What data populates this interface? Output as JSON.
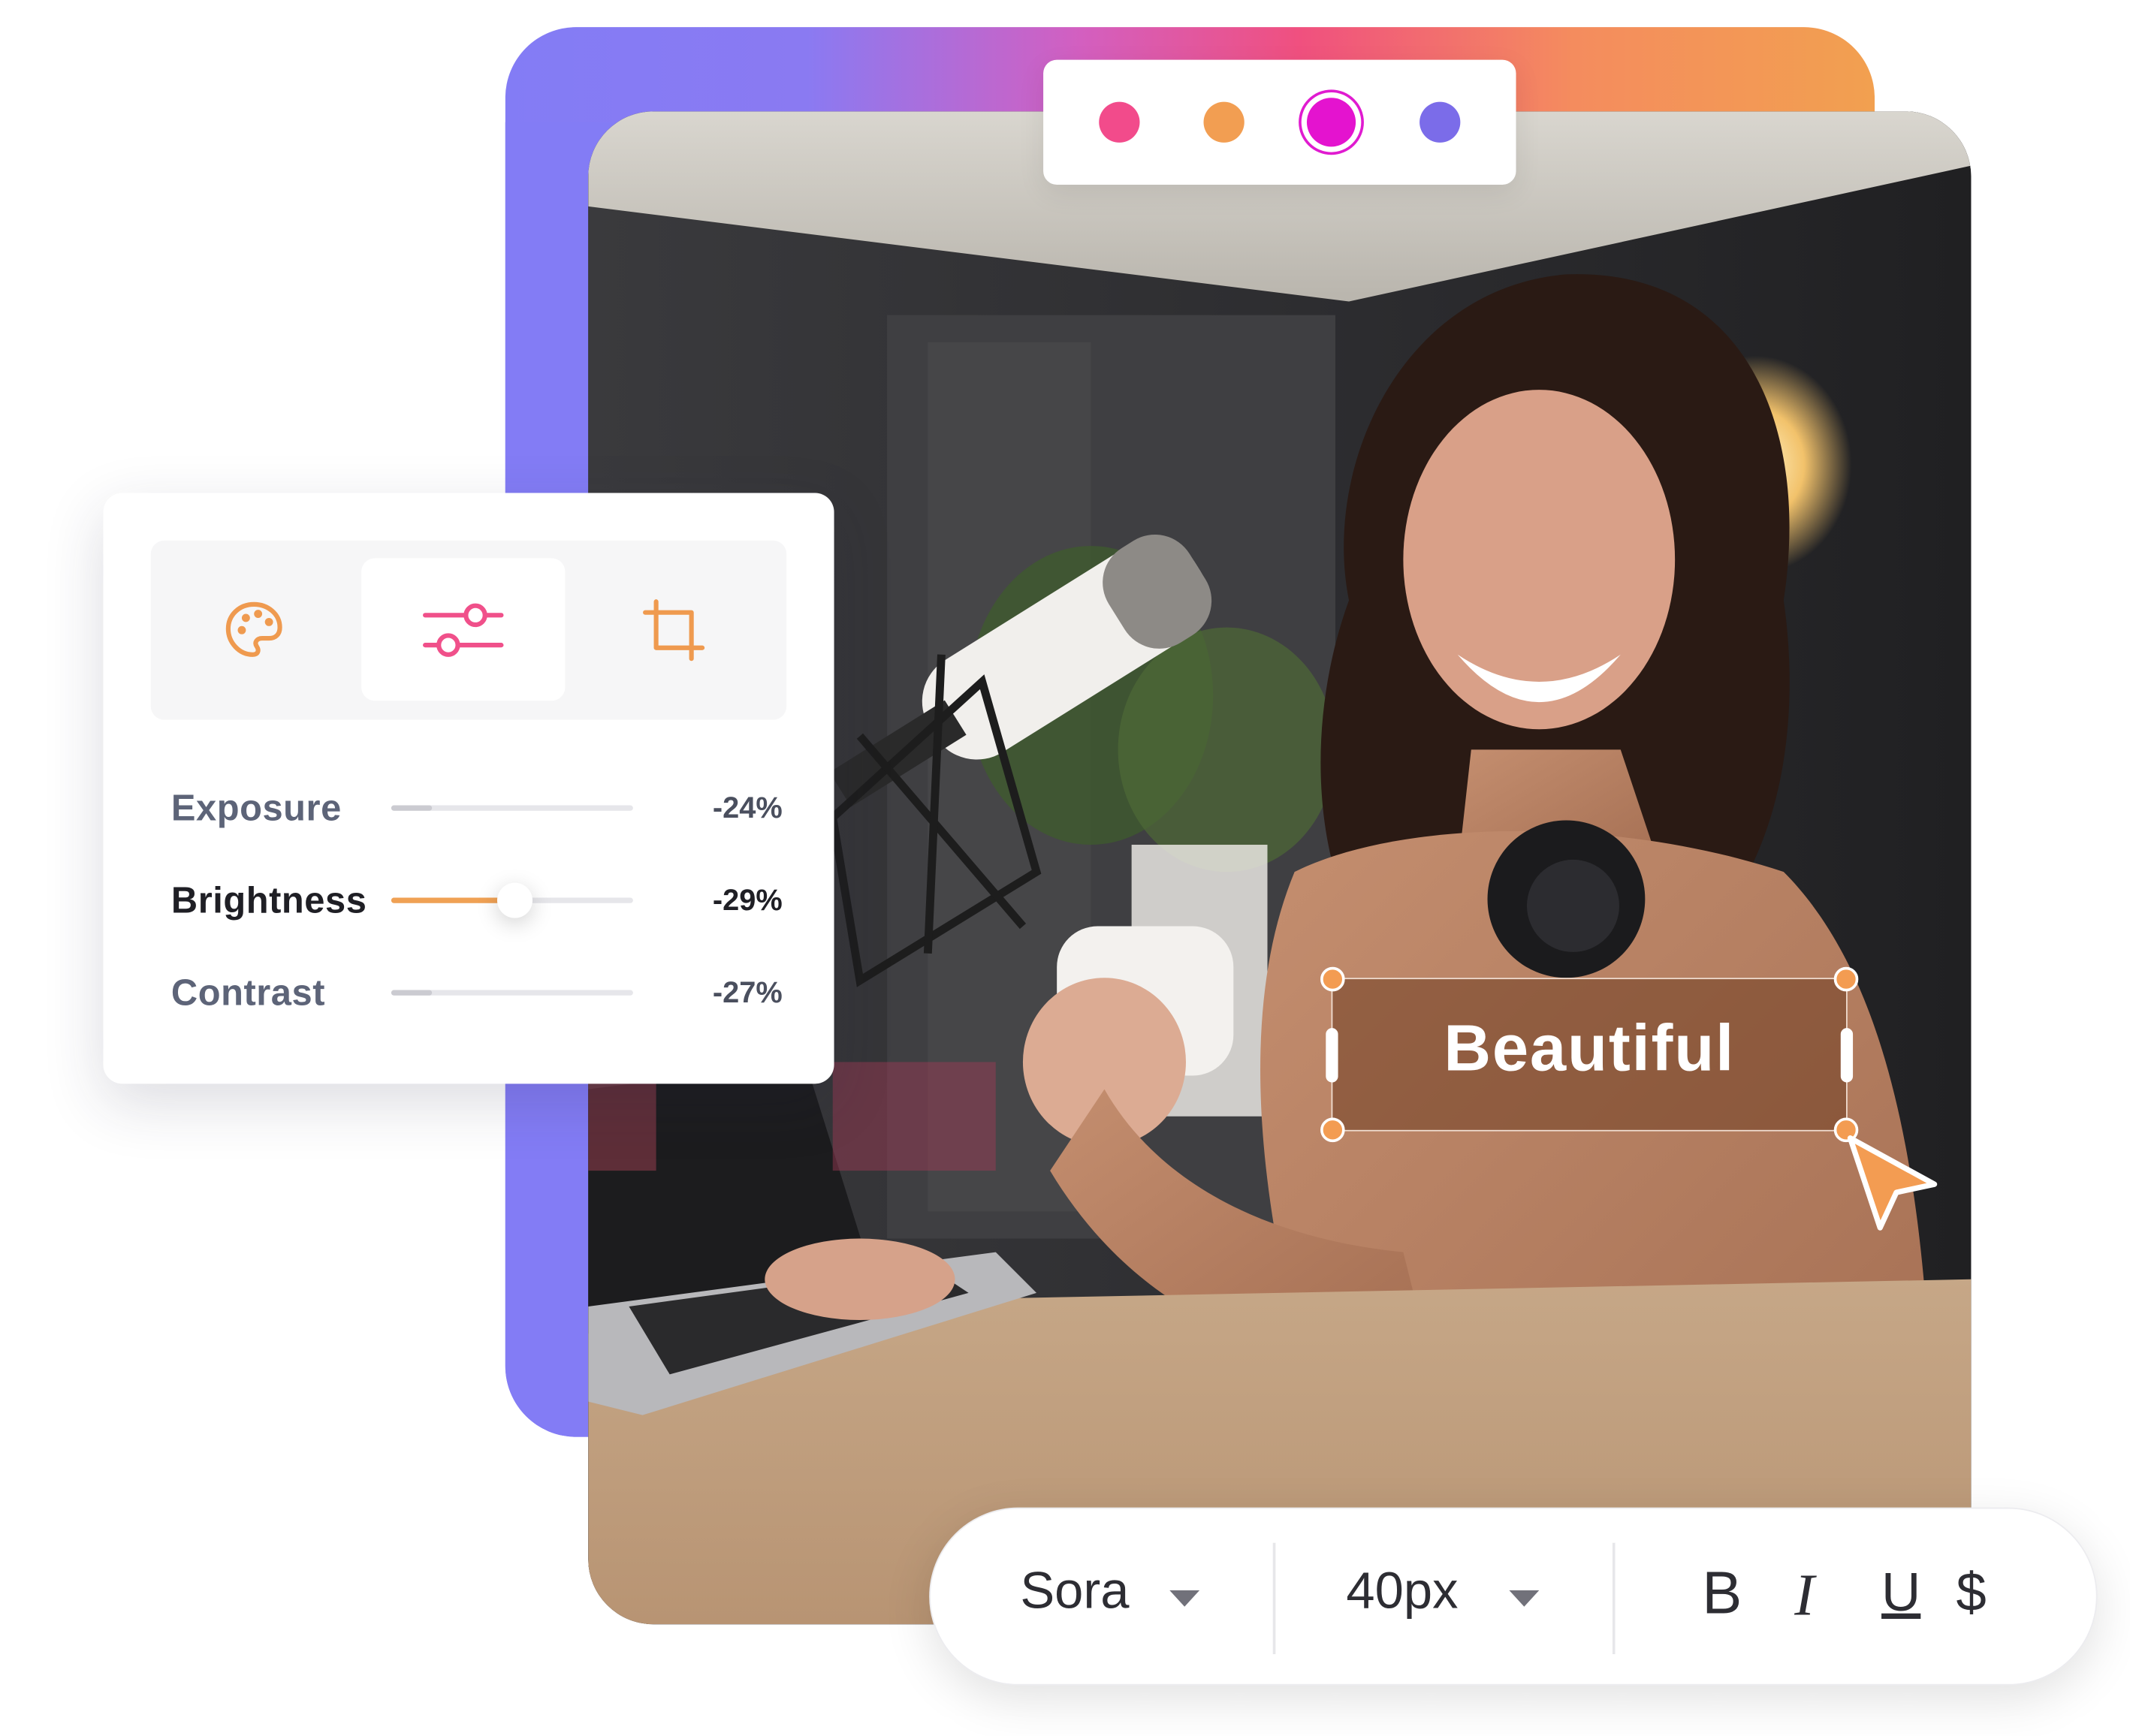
{
  "color_picker": {
    "swatches": [
      {
        "name": "pink",
        "color": "#f24b8b",
        "selected": false
      },
      {
        "name": "orange",
        "color": "#f29e52",
        "selected": false
      },
      {
        "name": "magenta",
        "color": "#e413cf",
        "selected": true
      },
      {
        "name": "purple",
        "color": "#7b6ce9",
        "selected": false
      }
    ]
  },
  "adjust_panel": {
    "tabs": [
      {
        "icon": "palette-icon",
        "active": false
      },
      {
        "icon": "sliders-icon",
        "active": true
      },
      {
        "icon": "crop-icon",
        "active": false
      }
    ],
    "adjustments": [
      {
        "label": "Exposure",
        "value": "-24%",
        "level": 0.17,
        "active": false
      },
      {
        "label": "Brightness",
        "value": "-29%",
        "level": 0.51,
        "active": true
      },
      {
        "label": "Contrast",
        "value": "-27%",
        "level": 0.17,
        "active": false
      }
    ]
  },
  "canvas": {
    "text_layer": "Beautiful",
    "cursor_icon": "pointer-arrow-icon"
  },
  "font_toolbar": {
    "font_family": "Sora",
    "font_size": "40px",
    "bold_label": "B",
    "italic_label": "I",
    "underline_label": "U",
    "strike_label": "$"
  },
  "colors": {
    "accent_orange": "#f29e52",
    "accent_pink": "#f0508a",
    "gradient_start": "#837cf5",
    "gradient_end": "#f2a050"
  }
}
